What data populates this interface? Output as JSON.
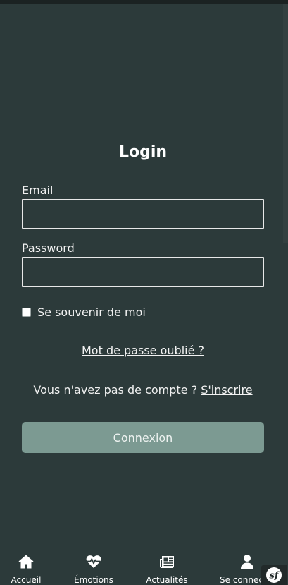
{
  "form": {
    "title": "Login",
    "email_label": "Email",
    "email_value": "",
    "password_label": "Password",
    "password_value": "",
    "remember_label": "Se souvenir de moi",
    "remember_checked": false,
    "forgot_link": "Mot de passe oublié ?",
    "no_account_text": "Vous n'avez pas de compte ? ",
    "register_link": "S'inscrire",
    "submit_label": "Connexion"
  },
  "nav": {
    "items": [
      {
        "label": "Accueil",
        "icon": "home-icon"
      },
      {
        "label": "Émotions",
        "icon": "heart-pulse-icon"
      },
      {
        "label": "Actualités",
        "icon": "newspaper-icon"
      },
      {
        "label": "Se connec",
        "icon": "user-icon"
      }
    ]
  },
  "toolbar": {
    "icon": "symfony-icon"
  },
  "colors": {
    "background": "#2c3a3a",
    "button": "#7c9a92",
    "text": "#ffffff"
  }
}
